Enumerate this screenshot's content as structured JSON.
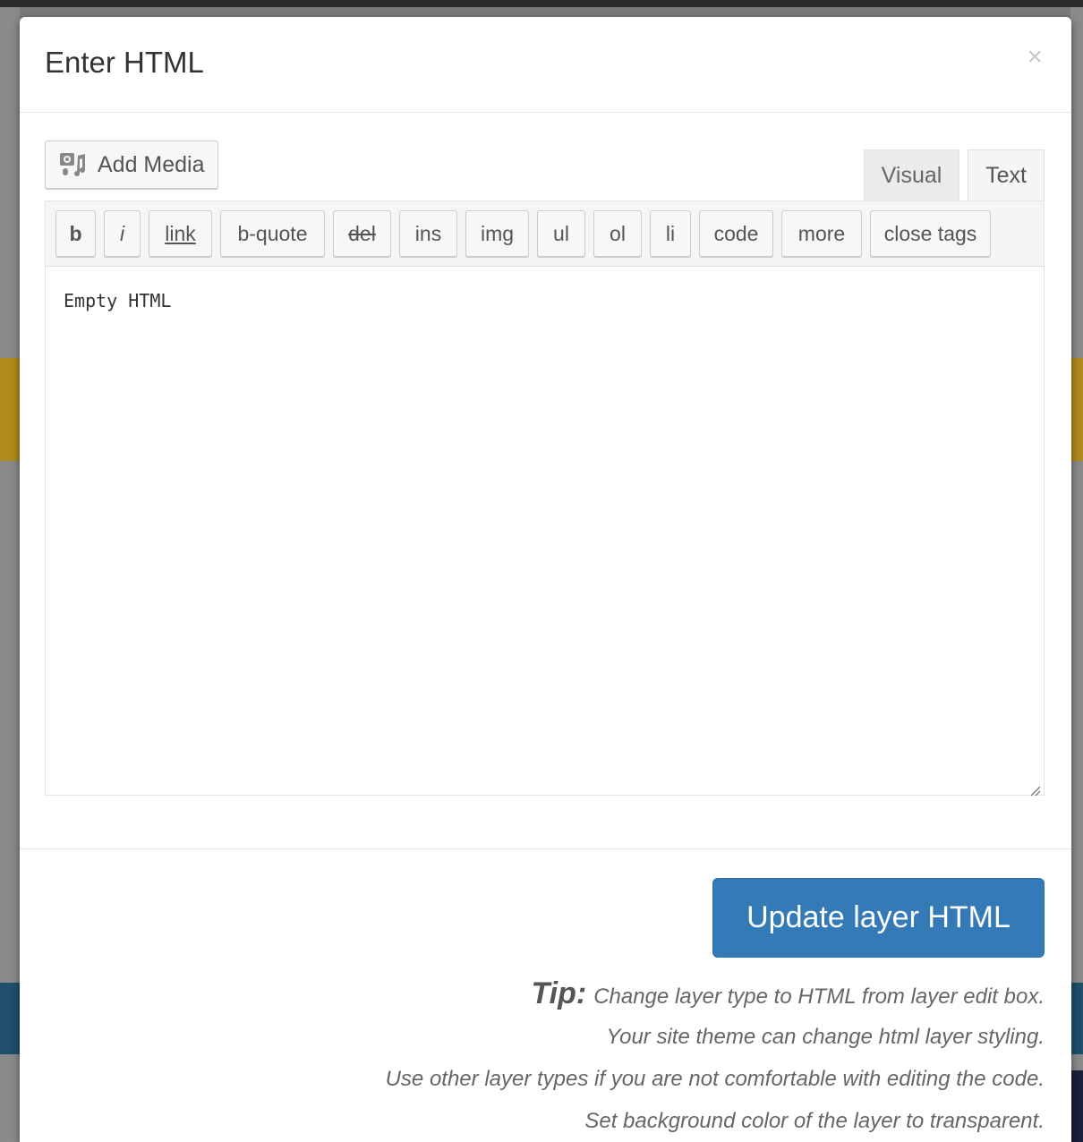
{
  "modal": {
    "title": "Enter HTML",
    "close_glyph": "×"
  },
  "editor": {
    "add_media_label": "Add Media",
    "add_media_icon": "media-icon",
    "tabs": [
      {
        "label": "Visual",
        "active": false
      },
      {
        "label": "Text",
        "active": true
      }
    ],
    "quicktags": [
      "b",
      "i",
      "link",
      "b-quote",
      "del",
      "ins",
      "img",
      "ul",
      "ol",
      "li",
      "code",
      "more",
      "close tags"
    ],
    "content": "Empty HTML"
  },
  "footer": {
    "update_button_label": "Update layer HTML",
    "tip_label": "Tip:",
    "tips": [
      "Change layer type to HTML from layer edit box.",
      "Your site theme can change html layer styling.",
      "Use other layer types if you are not comfortable with editing the code.",
      "Set background color of the layer to transparent."
    ]
  },
  "colors": {
    "primary_button": "#337ab7",
    "modal_background": "#ffffff",
    "text_default": "#333333"
  }
}
